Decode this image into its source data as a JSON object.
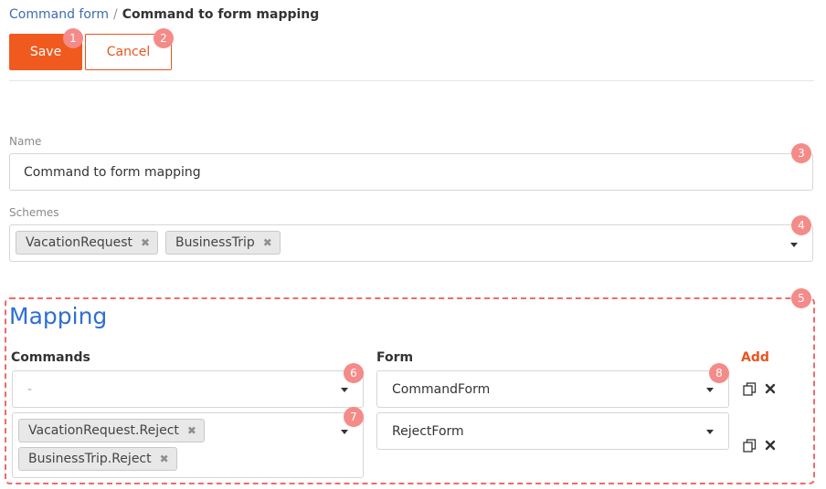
{
  "breadcrumb": {
    "parent": "Command form",
    "separator": "/",
    "current": "Command to form mapping"
  },
  "toolbar": {
    "save_label": "Save",
    "cancel_label": "Cancel"
  },
  "badges": [
    "1",
    "2",
    "3",
    "4",
    "5",
    "6",
    "7",
    "8"
  ],
  "name_field": {
    "label": "Name",
    "value": "Command to form mapping"
  },
  "schemes_field": {
    "label": "Schemes",
    "tags": [
      "VacationRequest",
      "BusinessTrip"
    ]
  },
  "mapping": {
    "title": "Mapping",
    "commands_header": "Commands",
    "form_header": "Form",
    "add_label": "Add",
    "rows": [
      {
        "commands_placeholder": "-",
        "commands": [],
        "form": "CommandForm"
      },
      {
        "commands_placeholder": "",
        "commands": [
          "VacationRequest.Reject",
          "BusinessTrip.Reject"
        ],
        "form": "RejectForm"
      }
    ]
  },
  "colors": {
    "accent": "#f15a1e",
    "link": "#3c6db0",
    "title": "#2f6fd4",
    "badge": "#f48b88",
    "highlight_border": "#f06a6a"
  },
  "icons": {
    "tag_remove": "close-icon",
    "row_copy": "copy-icon",
    "row_delete": "delete-icon",
    "dropdown": "caret-down-icon"
  }
}
